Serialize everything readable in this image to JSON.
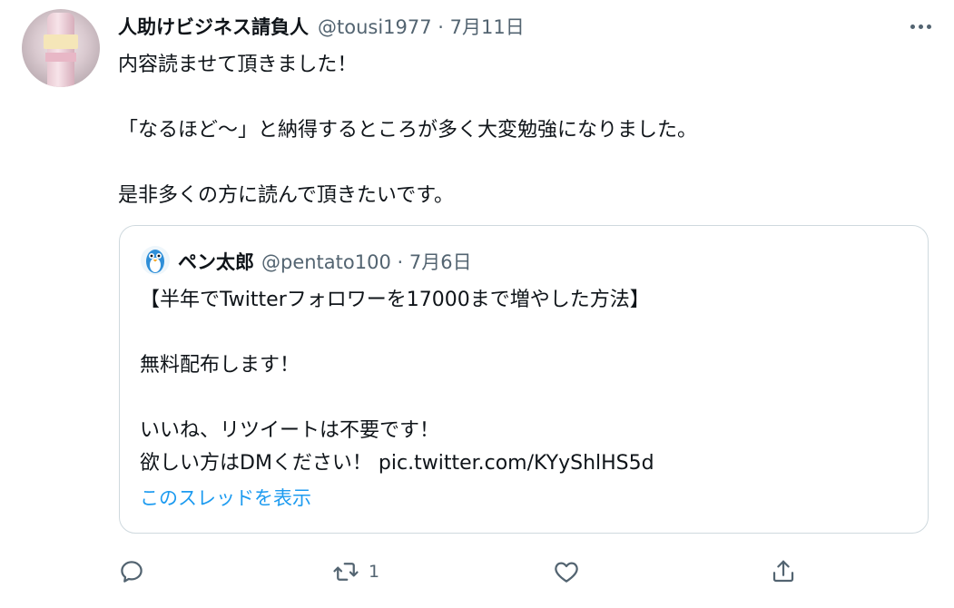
{
  "tweet": {
    "author_name": "人助けビジネス請負人",
    "handle_and_date": "@tousi1977 · 7月11日",
    "lines": [
      "内容読ませて頂きました！",
      "",
      "「なるほど〜」と納得するところが多く大変勉強になりました。",
      "",
      "是非多くの方に読んで頂きたいです。"
    ]
  },
  "quote": {
    "author_name": "ペン太郎",
    "handle_and_date": "@pentato100 · 7月6日",
    "lines": [
      "【半年でTwitterフォロワーを17000まで増やした方法】",
      "",
      "無料配布します！",
      "",
      "いいね、リツイートは不要です！",
      "欲しい方はDMください！ pic.twitter.com/KYyShlHS5d"
    ],
    "thread_link": "このスレッドを表示"
  },
  "actions": {
    "reply_count": "",
    "retweet_count": "1",
    "like_count": ""
  },
  "icons": {
    "more": "more-horizontal-icon",
    "reply": "reply-icon",
    "retweet": "retweet-icon",
    "like": "heart-icon",
    "share": "share-icon"
  },
  "colors": {
    "text": "#0f1419",
    "muted": "#536471",
    "link": "#1d9bf0",
    "border": "#cfd9de"
  }
}
